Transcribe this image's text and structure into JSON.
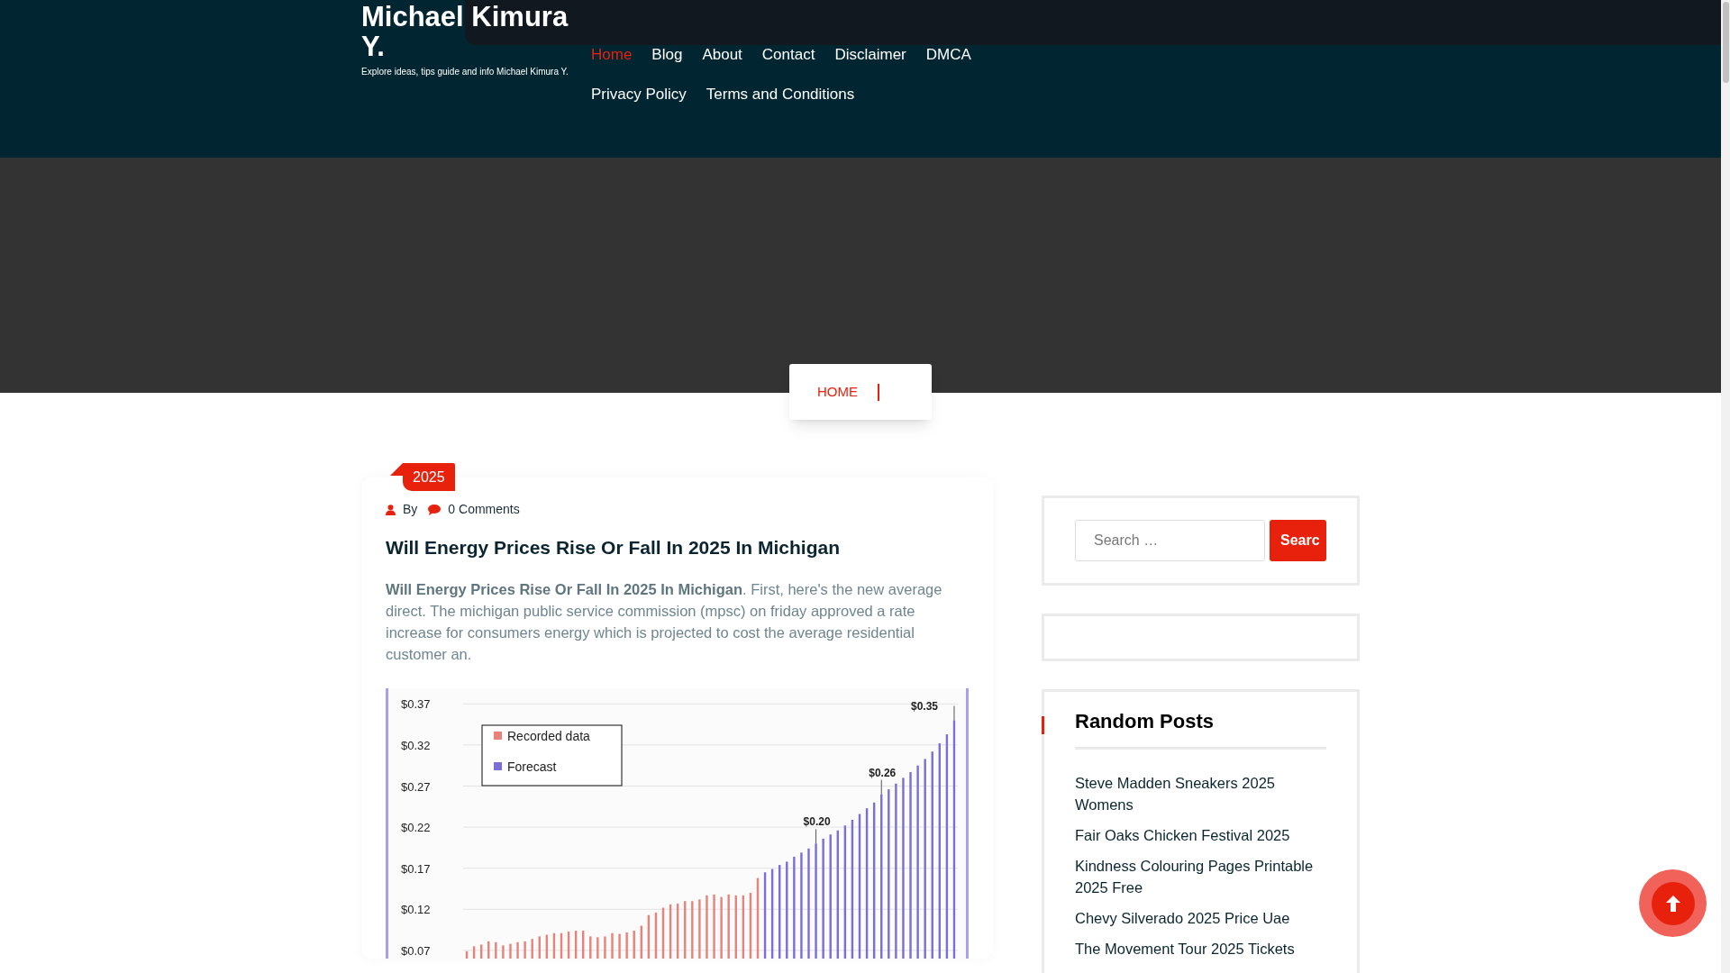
{
  "site": {
    "title": "Michael Kimura Y.",
    "tagline": "Explore ideas, tips guide and info Michael Kimura Y."
  },
  "nav": [
    {
      "label": "Home",
      "selected": true
    },
    {
      "label": "Blog",
      "selected": false
    },
    {
      "label": "About",
      "selected": false
    },
    {
      "label": "Contact",
      "selected": false
    },
    {
      "label": "Disclaimer",
      "selected": false
    },
    {
      "label": "DMCA",
      "selected": false
    },
    {
      "label": "Privacy Policy",
      "selected": false
    },
    {
      "label": "Terms and Conditions",
      "selected": false
    }
  ],
  "breadcrumb": [
    "HOME"
  ],
  "post": {
    "tag": "2025",
    "author_label": "By",
    "comments": "0 Comments",
    "title": "Will Energy Prices Rise Or Fall In 2025 In Michigan",
    "excerpt": "**Will Energy Prices Rise Or Fall In 2025 In Michigan**. First, here's the new average direct. The michigan public service commission (mpsc) on friday approved a rate increase for consumers energy which is projected to cost the average residential customer an.",
    "chart_data": {
      "type": "bar",
      "ylim": [
        0.06,
        0.389
      ],
      "yticks": [
        {
          "value": 0.07,
          "label": "$0.07"
        },
        {
          "value": 0.12,
          "label": "$0.12"
        },
        {
          "value": 0.17,
          "label": "$0.17"
        },
        {
          "value": 0.22,
          "label": "$0.22"
        },
        {
          "value": 0.27,
          "label": "$0.27"
        },
        {
          "value": 0.32,
          "label": "$0.32"
        },
        {
          "value": 0.37,
          "label": "$0.37"
        }
      ],
      "series": [
        {
          "name": "Recorded data",
          "color": "#e8827a",
          "values": [
            0.069,
            0.075,
            0.077,
            0.081,
            0.08,
            0.076,
            0.078,
            0.08,
            0.081,
            0.084,
            0.087,
            0.089,
            0.091,
            0.091,
            0.093,
            0.094,
            0.094,
            0.087,
            0.086,
            0.087,
            0.091,
            0.09,
            0.092,
            0.094,
            0.1,
            0.113,
            0.116,
            0.122,
            0.126,
            0.127,
            0.13,
            0.13,
            0.132,
            0.137,
            0.138,
            0.135,
            0.138,
            0.137,
            0.137,
            0.14,
            0.158,
            null,
            null,
            null,
            null,
            null,
            null,
            null,
            null,
            null,
            null,
            null,
            null,
            null,
            null,
            null,
            null,
            null,
            null,
            null,
            null,
            null,
            null,
            null,
            null,
            null,
            null,
            null
          ]
        },
        {
          "name": "Forecast",
          "color": "#7a6fd6",
          "values": [
            null,
            null,
            null,
            null,
            null,
            null,
            null,
            null,
            null,
            null,
            null,
            null,
            null,
            null,
            null,
            null,
            null,
            null,
            null,
            null,
            null,
            null,
            null,
            null,
            null,
            null,
            null,
            null,
            null,
            null,
            null,
            null,
            null,
            null,
            null,
            null,
            null,
            null,
            null,
            null,
            null,
            0.165,
            0.169,
            0.174,
            0.178,
            0.184,
            0.189,
            0.194,
            0.2,
            0.206,
            0.211,
            0.216,
            0.222,
            0.229,
            0.236,
            0.243,
            0.25,
            0.26,
            0.266,
            0.273,
            0.28,
            0.287,
            0.295,
            0.303,
            0.312,
            0.322,
            0.333,
            0.35
          ]
        }
      ],
      "grid": true,
      "legend": true,
      "annotations": [
        {
          "y": 0.2,
          "text": "$0.20"
        },
        {
          "y": 0.26,
          "text": "$0.26"
        },
        "$0.35"
      ]
    }
  },
  "sidebar": {
    "search": {
      "placeholder": "Search …",
      "button": "Searc"
    },
    "random_posts": {
      "title": "Random Posts",
      "items": [
        "Steve Madden Sneakers 2025 Womens",
        "Fair Oaks Chicken Festival 2025",
        "Kindness Colouring Pages Printable 2025 Free",
        "Chevy Silverado 2025 Price Uae",
        "The Movement Tour 2025 Tickets"
      ]
    }
  }
}
